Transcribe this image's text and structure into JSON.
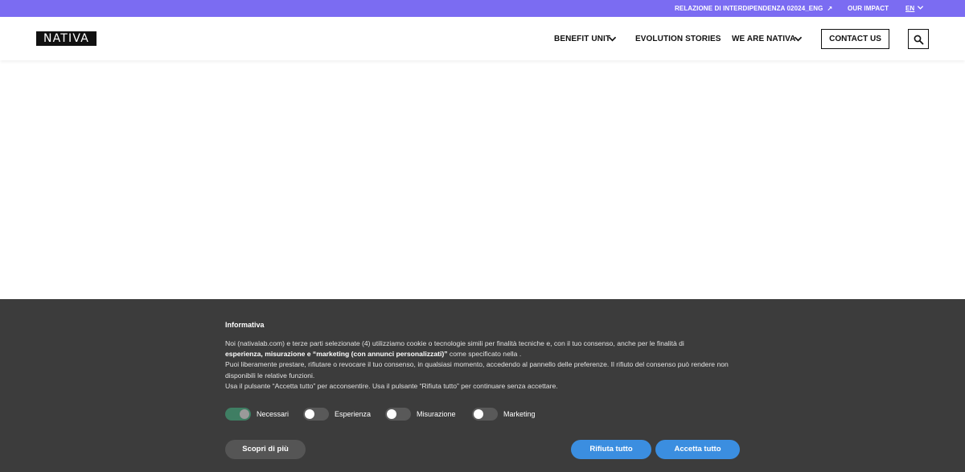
{
  "topbar": {
    "relazione_label": "RELAZIONE DI INTERDIPENDENZA 02024_ENG",
    "relazione_arrow": "↗",
    "impact_label": "OUR IMPACT",
    "lang_label": "EN",
    "bg_color": "#7b6cf2"
  },
  "header": {
    "logo_text": "NATIVA",
    "nav": {
      "benefit_unit": "BENEFIT UNIT",
      "evolution_stories": "EVOLUTION STORIES",
      "we_are_nativa": "WE ARE NATIVA"
    },
    "contact_label": "CONTACT US",
    "search_icon": "search-icon"
  },
  "cookie": {
    "title": "Informativa",
    "line1_a": "Noi (nativalab.com) e terze parti selezionate (4) utilizziamo cookie o tecnologie simili per finalità tecniche e, con il tuo consenso, anche per le finalità di",
    "line2_bold": "esperienza, misurazione e “marketing (con annunci personalizzati)”",
    "line2_rest": " come specificato nella .",
    "line3": "Puoi liberamente prestare, rifiutare o revocare il tuo consenso, in qualsiasi momento, accedendo al pannello delle preferenze. Il rifiuto del consenso può rendere non disponibili le relative funzioni.",
    "line4": "Usa il pulsante “Accetta tutto” per acconsentire. Usa il pulsante “Rifiuta tutto” per continuare senza accettare.",
    "toggles": [
      {
        "label": "Necessari",
        "on": true
      },
      {
        "label": "Esperienza",
        "on": false
      },
      {
        "label": "Misurazione",
        "on": false
      },
      {
        "label": "Marketing",
        "on": false
      }
    ],
    "more_label": "Scopri di più",
    "reject_label": "Rifiuta tutto",
    "accept_label": "Accetta tutto",
    "accent_color": "#3b8ee0",
    "bg_color": "#3c3c3c"
  }
}
